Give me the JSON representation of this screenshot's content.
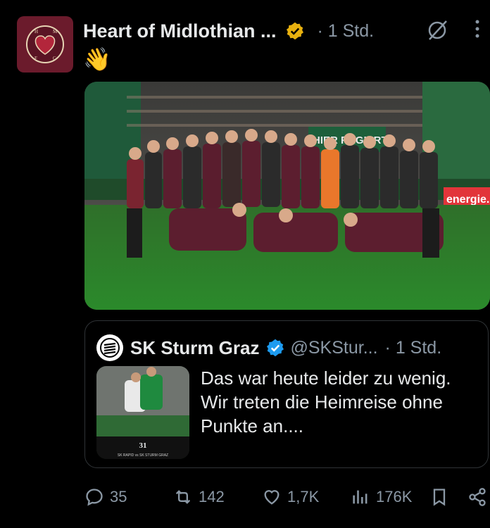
{
  "post": {
    "author_name": "Heart of Midlothian ...",
    "time": "· 1 Std.",
    "emoji": "👋",
    "avatar_label": "H M F C 1874"
  },
  "quote": {
    "author_name": "SK Sturm Graz",
    "handle": "@SKStur...",
    "time": "· 1 Std.",
    "text": "Das war heute leider zu wenig. Wir treten die Heimreise ohne Punkte an....",
    "thumb_number": "31",
    "thumb_caption": "SK RAPID vs SK STURM GRAZ"
  },
  "actions": {
    "replies": "35",
    "reposts": "142",
    "likes": "1,7K",
    "views": "176K"
  },
  "photo": {
    "banner_text": "HIER REGIERT",
    "sponsor_text": "energie."
  },
  "colors": {
    "background": "#000000",
    "text_primary": "#e7e9ea",
    "text_secondary": "#8b98a5",
    "verified_gold": "#e8b10f",
    "verified_blue": "#1d9bf0"
  }
}
